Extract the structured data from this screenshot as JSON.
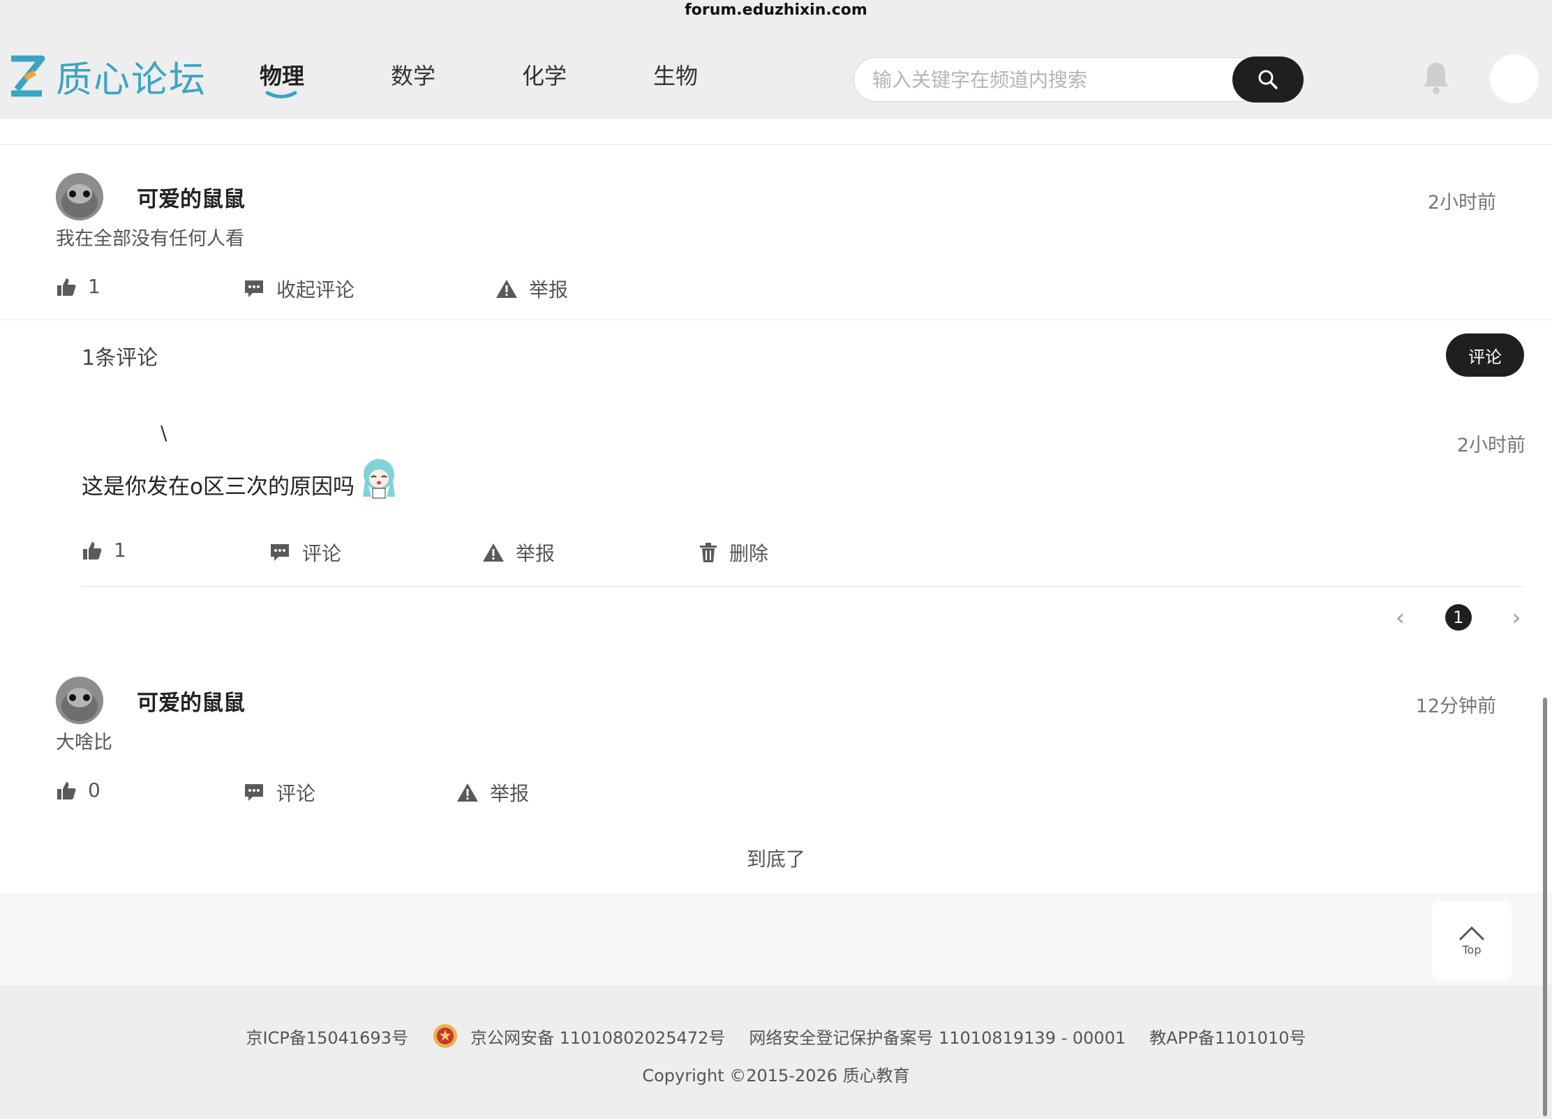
{
  "browser": {
    "url": "forum.eduzhixin.com"
  },
  "header": {
    "logo_text": "质心论坛",
    "nav": [
      {
        "label": "物理",
        "active": true
      },
      {
        "label": "数学",
        "active": false
      },
      {
        "label": "化学",
        "active": false
      },
      {
        "label": "生物",
        "active": false
      }
    ],
    "search_placeholder": "输入关键字在频道内搜索",
    "icons": {
      "search": "search-icon",
      "bell": "bell-icon",
      "avatar": "user-avatar"
    }
  },
  "posts": [
    {
      "author": "可爱的鼠鼠",
      "time": "2小时前",
      "text": "我在全部没有任何人看",
      "likes": "1",
      "comment_label": "收起评论",
      "report_label": "举报"
    },
    {
      "author": "可爱的鼠鼠",
      "time": "12分钟前",
      "text": "大啥比",
      "likes": "0",
      "comment_label": "评论",
      "report_label": "举报"
    }
  ],
  "comments_section": {
    "count_label": "1条评论",
    "comment_button": "评论",
    "reply": {
      "name": "\\",
      "time": "2小时前",
      "text": "这是你发在o区三次的原因吗",
      "likes": "1",
      "comment_label": "评论",
      "report_label": "举报",
      "delete_label": "删除"
    },
    "pagination": {
      "current": "1",
      "prev": "‹",
      "next": "›"
    }
  },
  "end_text": "到底了",
  "top_button": "Top",
  "footer": {
    "icp": "京ICP备15041693号",
    "police": "京公网安备 11010802025472号",
    "security": "网络安全登记保护备案号 11010819139 - 00001",
    "app": "教APP备1101010号",
    "copyright": "Copyright ©2015-2026 质心教育"
  },
  "colors": {
    "brand": "#3aa4c4",
    "accent_dark": "#1f1f1f",
    "logo_orange": "#f2a23a"
  }
}
